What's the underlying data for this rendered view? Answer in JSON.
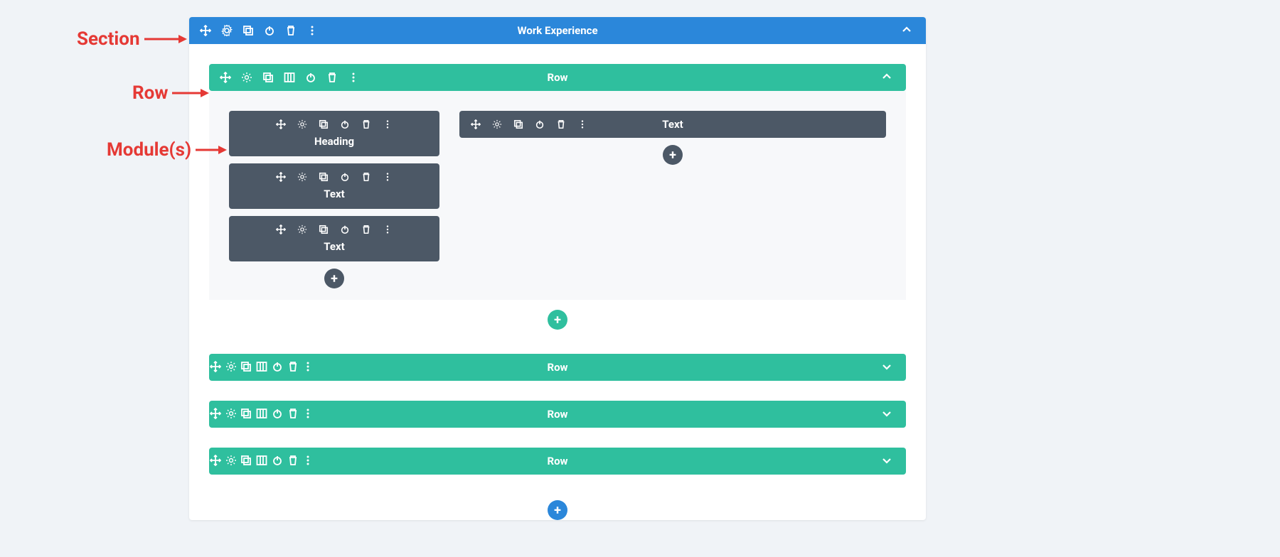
{
  "colors": {
    "section": "#2b87da",
    "row": "#2fbf9e",
    "module": "#4c5866",
    "annotation": "#e53935"
  },
  "annotations": {
    "section": "Section",
    "row": "Row",
    "modules": "Module(s)"
  },
  "section": {
    "title": "Work Experience"
  },
  "row1": {
    "title": "Row",
    "col_left": {
      "modules": [
        {
          "label": "Heading"
        },
        {
          "label": "Text"
        },
        {
          "label": "Text"
        }
      ]
    },
    "col_right": {
      "module": {
        "label": "Text"
      }
    }
  },
  "collapsed_rows": [
    {
      "title": "Row"
    },
    {
      "title": "Row"
    },
    {
      "title": "Row"
    }
  ],
  "glyphs": {
    "plus": "+"
  }
}
